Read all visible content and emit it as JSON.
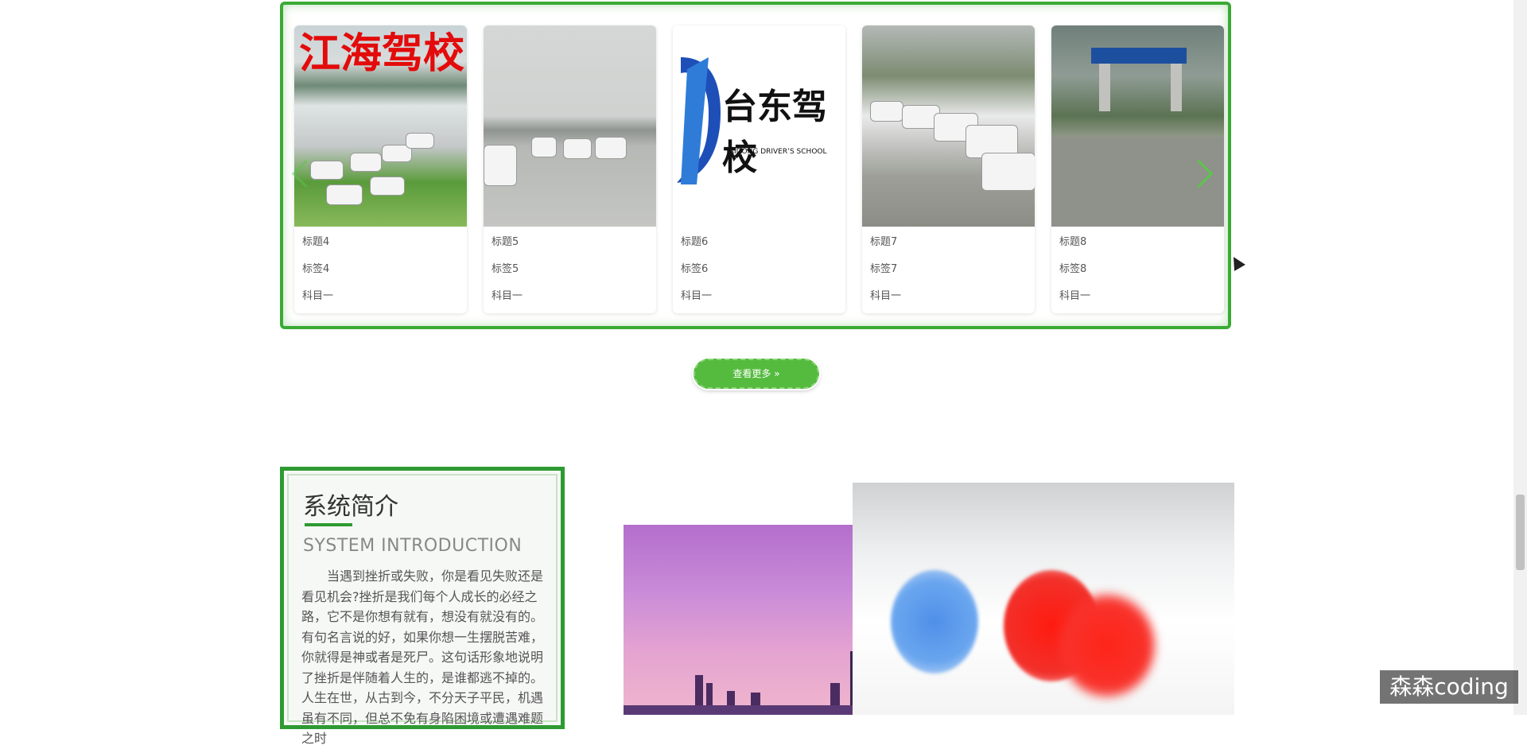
{
  "carousel": {
    "cards": [
      {
        "image_text": "江海驾校",
        "title": "标题4",
        "tag": "标签4",
        "subject": "科目一"
      },
      {
        "image_text": "",
        "title": "标题5",
        "tag": "标签5",
        "subject": "科目一"
      },
      {
        "image_text": "台东驾校",
        "image_subtext": "TAIDONG DRIVER’S SCHOOL",
        "title": "标题6",
        "tag": "标签6",
        "subject": "科目一"
      },
      {
        "image_text": "",
        "title": "标题7",
        "tag": "标签7",
        "subject": "科目一"
      },
      {
        "image_text": "",
        "title": "标题8",
        "tag": "标签8",
        "subject": "科目一"
      }
    ],
    "accent_color": "#3aaa35",
    "next_icon": "chevron-right-icon",
    "prev_icon": "chevron-left-icon"
  },
  "more_button": {
    "label": "查看更多 »",
    "color": "#55bb3f"
  },
  "intro": {
    "title": "系统简介",
    "subtitle": "SYSTEM INTRODUCTION",
    "paragraph": "当遇到挫折或失败，你是看见失败还是看见机会?挫折是我们每个人成长的必经之路，它不是你想有就有，想没有就没有的。有句名言说的好，如果你想一生摆脱苦难，你就得是神或者是死尸。这句话形象地说明了挫折是伴随着人生的，是谁都逃不掉的。人生在世，从古到今，不分天子平民，机遇虽有不同，但总不免有身陷困境或遭遇难题之时"
  },
  "watermark": "森森coding"
}
